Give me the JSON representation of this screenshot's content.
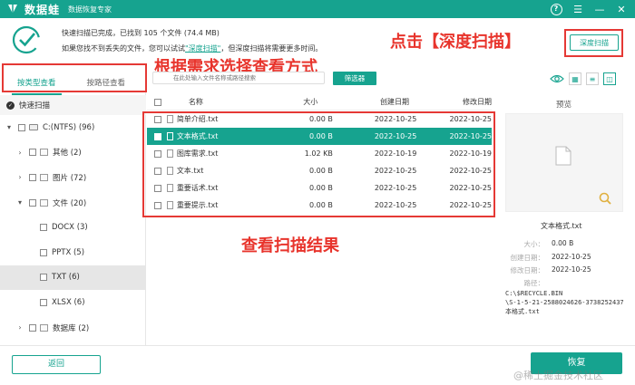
{
  "app": {
    "name": "数据蛙",
    "subtitle": "数据恢复专家"
  },
  "status": {
    "line1": "快速扫描已完成，已找到 105 个文件 (74.4 MB)",
    "line2_prefix": "如果您找不到丢失的文件，您可以试试",
    "line2_link": "\"深度扫描\"",
    "line2_suffix": "，但深度扫描将需要更多时间。"
  },
  "annotations": {
    "deep_scan": "点击【深度扫描】",
    "choose_view": "根据需求选择查看方式",
    "view_results": "查看扫描结果"
  },
  "deep_scan_button": "深度扫描",
  "view_tabs": {
    "by_type": "按类型查看",
    "by_path": "按路径查看"
  },
  "tree": {
    "header": "快速扫描",
    "items": [
      {
        "label": "C:(NTFS) (96)",
        "level": 0,
        "chevron": "▾",
        "checked": false,
        "icon": "drive"
      },
      {
        "label": "其他 (2)",
        "level": 1,
        "chevron": "›",
        "checked": false,
        "icon": "folder"
      },
      {
        "label": "图片 (72)",
        "level": 1,
        "chevron": "›",
        "checked": false,
        "icon": "image"
      },
      {
        "label": "文件 (20)",
        "level": 1,
        "chevron": "▾",
        "checked": false,
        "icon": "folder"
      },
      {
        "label": "DOCX (3)",
        "level": 2,
        "chevron": "",
        "checked": false,
        "icon": ""
      },
      {
        "label": "PPTX (5)",
        "level": 2,
        "chevron": "",
        "checked": false,
        "icon": ""
      },
      {
        "label": "TXT (6)",
        "level": 2,
        "chevron": "",
        "checked": false,
        "icon": "",
        "selected": true
      },
      {
        "label": "XLSX (6)",
        "level": 2,
        "chevron": "",
        "checked": false,
        "icon": ""
      },
      {
        "label": "数据库 (2)",
        "level": 1,
        "chevron": "›",
        "checked": false,
        "icon": "folder"
      }
    ]
  },
  "search": {
    "placeholder": "在此处输入文件名称或路径搜索"
  },
  "filter_button": "筛选器",
  "table": {
    "columns": {
      "name": "名称",
      "size": "大小",
      "created": "创建日期",
      "modified": "修改日期"
    },
    "rows": [
      {
        "name": "简单介绍.txt",
        "size": "0.00  B",
        "created": "2022-10-25",
        "modified": "2022-10-25",
        "selected": false
      },
      {
        "name": "文本格式.txt",
        "size": "0.00  B",
        "created": "2022-10-25",
        "modified": "2022-10-25",
        "selected": true
      },
      {
        "name": "图库需求.txt",
        "size": "1.02 KB",
        "created": "2022-10-19",
        "modified": "2022-10-19",
        "selected": false
      },
      {
        "name": "文本.txt",
        "size": "0.00  B",
        "created": "2022-10-25",
        "modified": "2022-10-25",
        "selected": false
      },
      {
        "name": "重要话术.txt",
        "size": "0.00  B",
        "created": "2022-10-25",
        "modified": "2022-10-25",
        "selected": false
      },
      {
        "name": "重要提示.txt",
        "size": "0.00  B",
        "created": "2022-10-25",
        "modified": "2022-10-25",
        "selected": false
      }
    ]
  },
  "preview": {
    "label": "预览",
    "file_name": "文本格式.txt",
    "meta": [
      {
        "key": "大小：",
        "value": "0.00  B"
      },
      {
        "key": "创建日期：",
        "value": "2022-10-25"
      },
      {
        "key": "修改日期：",
        "value": "2022-10-25"
      },
      {
        "key": "路径：",
        "value": ""
      }
    ],
    "path_lines": [
      "C:\\$RECYCLE.BIN",
      "\\S-1-5-21-2588024626-3738252437",
      "本格式.txt"
    ]
  },
  "back_button": "返回",
  "recover_button": "恢复",
  "watermark": "@稀土掘金技术社区",
  "colors": {
    "accent": "#16a38f",
    "annotation": "#e8342c"
  }
}
